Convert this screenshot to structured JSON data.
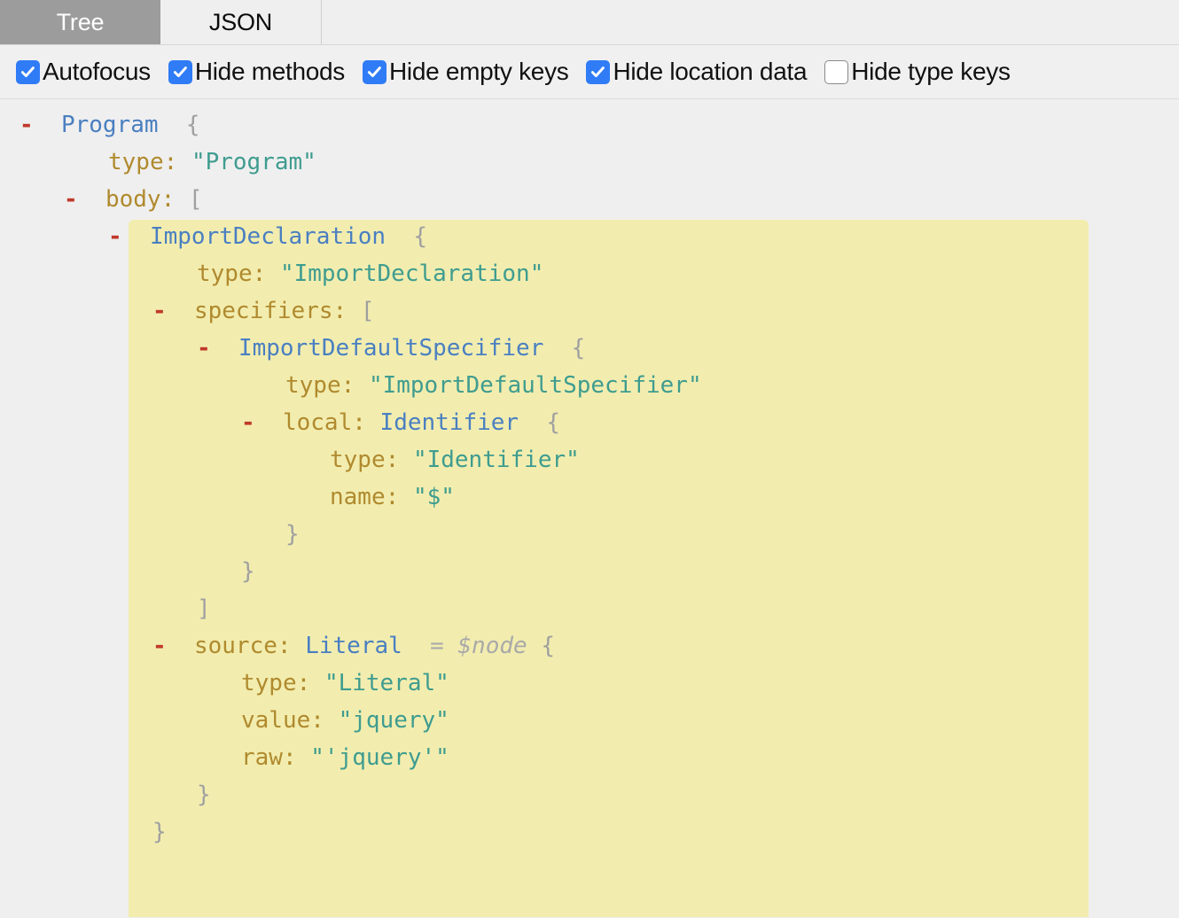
{
  "tabs": [
    {
      "label": "Tree",
      "active": true
    },
    {
      "label": "JSON",
      "active": false
    }
  ],
  "options": [
    {
      "label": "Autofocus",
      "checked": true
    },
    {
      "label": "Hide methods",
      "checked": true
    },
    {
      "label": "Hide empty keys",
      "checked": true
    },
    {
      "label": "Hide location data",
      "checked": true
    },
    {
      "label": "Hide type keys",
      "checked": false
    }
  ],
  "colors": {
    "accent_checkbox": "#2f7cf6",
    "active_tab_bg": "#9c9c9c",
    "highlight_bg": "#f2edaf",
    "toggle_minus": "#c0392b",
    "node_type": "#4a7fc1",
    "key": "#b08a2e",
    "string": "#3f9c8f",
    "punctuation": "#a0a0a0",
    "alias": "#a9a9a9",
    "panel_bg": "#efefef"
  },
  "tree": {
    "highlighted_node": "ImportDeclaration",
    "lines": [
      {
        "indent": 0,
        "toggle": "-",
        "nodetype": "Program",
        "punc": "{"
      },
      {
        "indent": 2,
        "key": "type:",
        "str": "\"Program\""
      },
      {
        "indent": 1,
        "toggle": "-",
        "key": "body:",
        "punc": "["
      },
      {
        "indent": 2,
        "toggle": "-",
        "nodetype": "ImportDeclaration",
        "punc": "{"
      },
      {
        "indent": 4,
        "key": "type:",
        "str": "\"ImportDeclaration\""
      },
      {
        "indent": 3,
        "toggle": "-",
        "key": "specifiers:",
        "punc": "["
      },
      {
        "indent": 4,
        "toggle": "-",
        "nodetype": "ImportDefaultSpecifier",
        "punc": "{"
      },
      {
        "indent": 6,
        "key": "type:",
        "str": "\"ImportDefaultSpecifier\""
      },
      {
        "indent": 5,
        "toggle": "-",
        "key": "local:",
        "nodetype": "Identifier",
        "punc": "{"
      },
      {
        "indent": 7,
        "key": "type:",
        "str": "\"Identifier\""
      },
      {
        "indent": 7,
        "key": "name:",
        "str": "\"$\""
      },
      {
        "indent": 6,
        "punc": "}"
      },
      {
        "indent": 5,
        "punc": "}"
      },
      {
        "indent": 4,
        "punc": "]"
      },
      {
        "indent": 3,
        "toggle": "-",
        "key": "source:",
        "nodetype": "Literal",
        "alias": "= $node",
        "punc": "{"
      },
      {
        "indent": 5,
        "key": "type:",
        "str": "\"Literal\""
      },
      {
        "indent": 5,
        "key": "value:",
        "str": "\"jquery\""
      },
      {
        "indent": 5,
        "key": "raw:",
        "str": "\"'jquery'\""
      },
      {
        "indent": 4,
        "punc": "}"
      },
      {
        "indent": 3,
        "punc": "}"
      }
    ]
  }
}
